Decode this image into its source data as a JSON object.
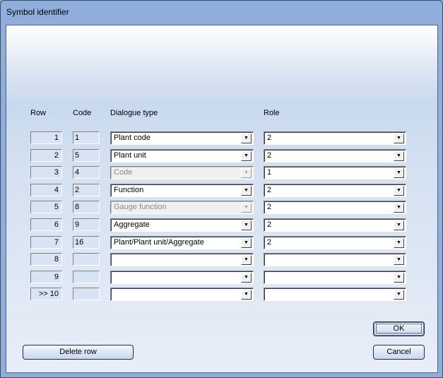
{
  "window": {
    "title": "Symbol identifier"
  },
  "headers": {
    "row": "Row",
    "code": "Code",
    "dialogue_type": "Dialogue type",
    "role": "Role"
  },
  "rows": [
    {
      "row": "1",
      "code": "1",
      "dialogue_type": "Plant code",
      "dialogue_enabled": true,
      "role": "2"
    },
    {
      "row": "2",
      "code": "5",
      "dialogue_type": "Plant unit",
      "dialogue_enabled": true,
      "role": "2"
    },
    {
      "row": "3",
      "code": "4",
      "dialogue_type": "Code",
      "dialogue_enabled": false,
      "role": "1"
    },
    {
      "row": "4",
      "code": "2",
      "dialogue_type": "Function",
      "dialogue_enabled": true,
      "role": "2"
    },
    {
      "row": "5",
      "code": "8",
      "dialogue_type": "Gauge function",
      "dialogue_enabled": false,
      "role": "2"
    },
    {
      "row": "6",
      "code": "9",
      "dialogue_type": "Aggregate",
      "dialogue_enabled": true,
      "role": "2"
    },
    {
      "row": "7",
      "code": "16",
      "dialogue_type": "Plant/Plant unit/Aggregate",
      "dialogue_enabled": true,
      "role": "2"
    },
    {
      "row": "8",
      "code": "",
      "dialogue_type": "",
      "dialogue_enabled": true,
      "role": ""
    },
    {
      "row": "9",
      "code": "",
      "dialogue_type": "",
      "dialogue_enabled": true,
      "role": ""
    },
    {
      "row": ">>  10",
      "code": "",
      "dialogue_type": "",
      "dialogue_enabled": true,
      "role": ""
    }
  ],
  "buttons": {
    "ok": "OK",
    "cancel": "Cancel",
    "delete_row": "Delete row"
  }
}
